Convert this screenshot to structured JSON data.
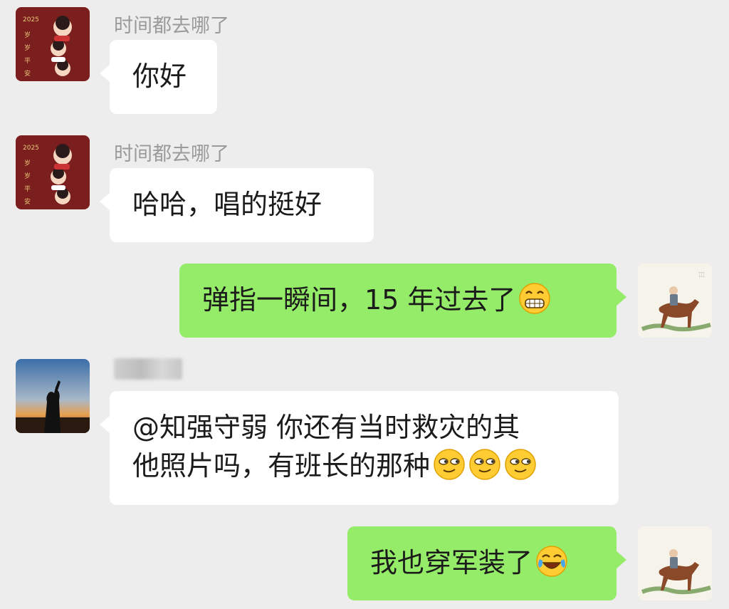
{
  "chat": {
    "messages": [
      {
        "sender": "时间都去哪了",
        "text": "你好"
      },
      {
        "sender": "时间都去哪了",
        "text": "哈哈，唱的挺好"
      },
      {
        "text": "弹指一瞬间，15 年过去了",
        "emoji": "grinning-face-icon"
      },
      {
        "line1": "@知强守弱  你还有当时救灾的其",
        "line2": "他照片吗，有班长的那种",
        "emoji": "smirking-face-icon"
      },
      {
        "text": "我也穿军装了",
        "emoji": "tears-of-joy-face-icon"
      }
    ]
  },
  "avatars": {
    "poster_year": "2025",
    "poster_text": "岁岁平安"
  },
  "colors": {
    "background": "#ededed",
    "incoming_bubble": "#ffffff",
    "outgoing_bubble": "#95ec69",
    "sender_name": "#9a9a9a"
  }
}
